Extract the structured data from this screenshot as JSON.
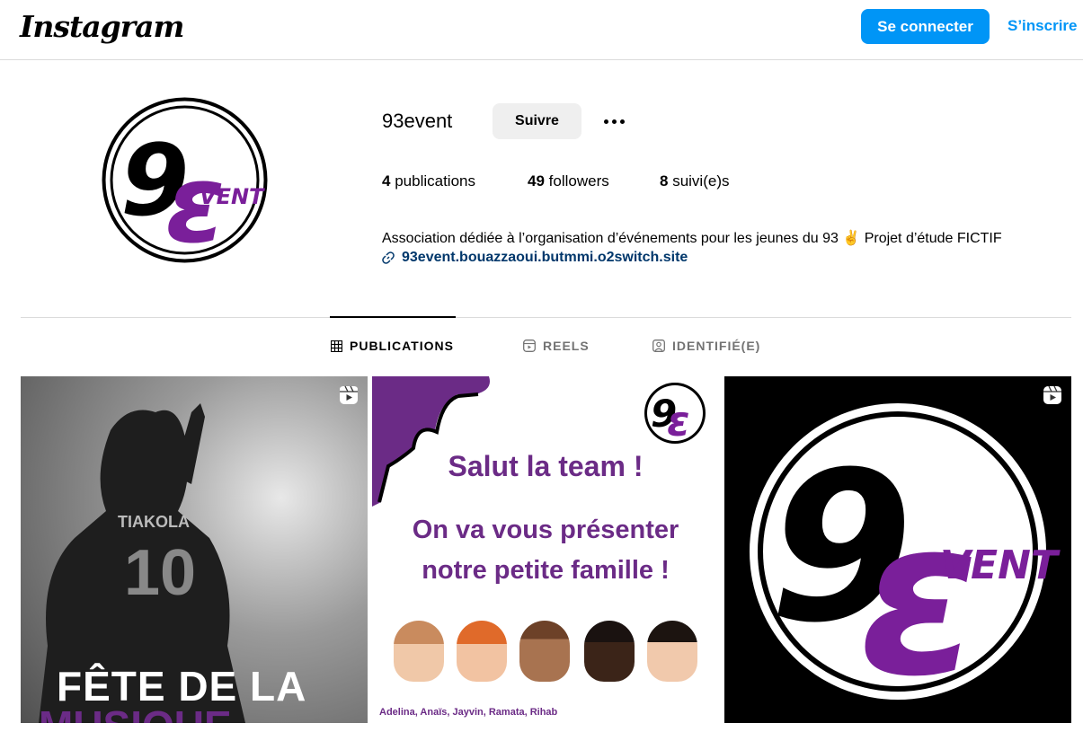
{
  "header": {
    "logo_text": "Instagram",
    "login_label": "Se connecter",
    "signup_label": "S’inscrire"
  },
  "profile": {
    "username": "93event",
    "follow_label": "Suivre",
    "stats": {
      "posts_count": "4",
      "posts_label": "publications",
      "followers_count": "49",
      "followers_label": "followers",
      "following_count": "8",
      "following_label": "suivi(e)s"
    },
    "bio": "Association dédiée à l’organisation d’événements pour les jeunes du 93 ✌️ Projet d’étude FICTIF",
    "link": "93event.bouazzaoui.butmmi.o2switch.site",
    "logo_text": "93 EVENT"
  },
  "tabs": [
    {
      "label": "PUBLICATIONS",
      "icon": "grid-icon",
      "active": true
    },
    {
      "label": "REELS",
      "icon": "reels-icon",
      "active": false
    },
    {
      "label": "IDENTIFIÉ(E)",
      "icon": "tagged-icon",
      "active": false
    }
  ],
  "posts": [
    {
      "type": "reel",
      "jersey_text": "TIAKOLA",
      "jersey_number": "10",
      "caption_line1": "FÊTE DE LA",
      "caption_line2": "MUSIQUE"
    },
    {
      "type": "image",
      "title": "Salut la team !",
      "subtitle_line1": "On va vous présenter",
      "subtitle_line2": "notre petite famille !",
      "names": "Adelina, Anaïs, Jayvin, Ramata, Rihab"
    },
    {
      "type": "reel",
      "logo_text": "93 EVENT"
    }
  ],
  "colors": {
    "accent_blue": "#0095f6",
    "brand_purple": "#6b2b86",
    "link_blue": "#00376b"
  }
}
